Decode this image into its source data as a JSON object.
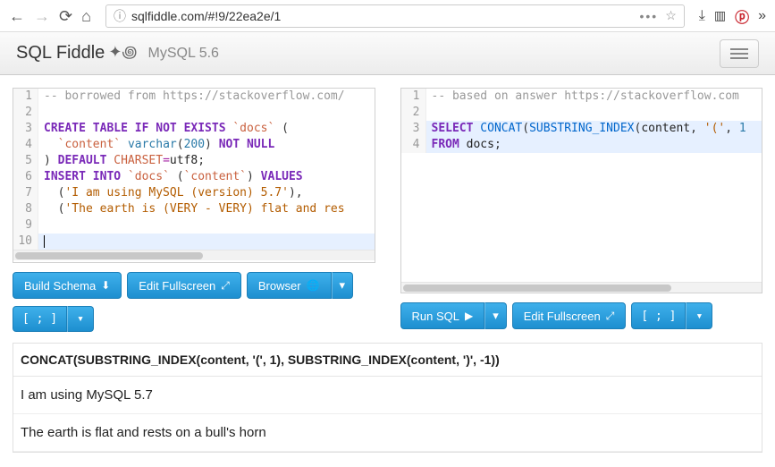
{
  "browser": {
    "url": "sqlfiddle.com/#!9/22ea2e/1"
  },
  "header": {
    "brand": "SQL Fiddle",
    "db": "MySQL 5.6"
  },
  "left_editor": {
    "lines": {
      "l1_comment": "-- borrowed from https://stackoverflow.com/",
      "l3": {
        "create": "CREATE",
        "table": "TABLE",
        "if": "IF",
        "not": "NOT",
        "exists": "EXISTS",
        "name": "`docs`",
        "open": "("
      },
      "l4": {
        "col": "`content`",
        "type": "varchar",
        "len": "200",
        "not": "NOT",
        "null": "NULL"
      },
      "l5": {
        "close": ")",
        "default": "DEFAULT",
        "charset": "CHARSET",
        "eq": "=",
        "val": "utf8",
        "semi": ";"
      },
      "l6": {
        "insert": "INSERT",
        "into": "INTO",
        "name": "`docs`",
        "open": "(",
        "col": "`content`",
        "close": ")",
        "values": "VALUES"
      },
      "l7": {
        "open": "  (",
        "str": "'I am using MySQL (version) 5.7'",
        "close": "),"
      },
      "l8": {
        "open": "  (",
        "str": "'The earth is (VERY - VERY) flat and res"
      }
    }
  },
  "right_editor": {
    "lines": {
      "l1_comment": "-- based on answer https://stackoverflow.com",
      "l3": {
        "select": "SELECT",
        "concat": "CONCAT",
        "open": "(",
        "sub": "SUBSTRING_INDEX",
        "open2": "(",
        "id": "content",
        "comma": ",",
        "sp": " ",
        "str": "'('",
        "comma2": ",",
        "sp2": " ",
        "tail": "1"
      },
      "l4": {
        "from": "FROM",
        "id": "docs",
        "semi": ";"
      }
    }
  },
  "buttons": {
    "build_schema": "Build Schema",
    "edit_fullscreen": "Edit Fullscreen",
    "browser": "Browser",
    "run_sql": "Run SQL",
    "format": "[ ; ]"
  },
  "results": {
    "header": "CONCAT(SUBSTRING_INDEX(content, '(', 1), SUBSTRING_INDEX(content, ')', -1))",
    "rows": [
      "I am using MySQL 5.7",
      "The earth is flat and rests on a bull's horn"
    ]
  }
}
